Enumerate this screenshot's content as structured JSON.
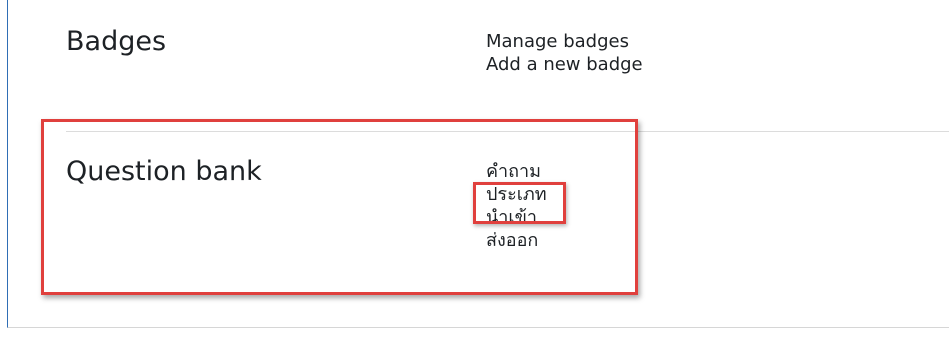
{
  "badges_section": {
    "title": "Badges",
    "links": [
      "Manage badges",
      "Add a new badge"
    ]
  },
  "question_bank_section": {
    "title": "Question bank",
    "links": [
      "คำถาม",
      "ประเภท",
      "นำเข้า",
      "ส่งออก"
    ]
  },
  "annotation": {
    "highlight_color": "#e0403d"
  },
  "colors": {
    "frame_left_border": "#2f6eb5",
    "text": "#1d2125",
    "divider": "#dcdcdc"
  }
}
